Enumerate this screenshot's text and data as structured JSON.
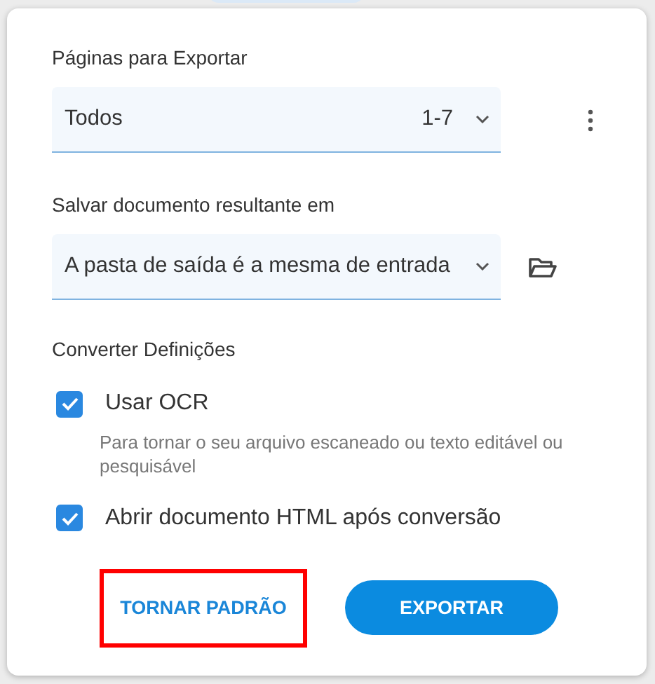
{
  "pages": {
    "label": "Páginas para Exportar",
    "value": "Todos",
    "range": "1-7"
  },
  "output": {
    "label": "Salvar documento resultante em",
    "value": "A pasta de saída é a mesma de entrada"
  },
  "settings": {
    "heading": "Converter Definições",
    "options": [
      {
        "label": "Usar OCR",
        "checked": true,
        "help": "Para tornar o seu arquivo escaneado ou texto editável ou pesquisável"
      },
      {
        "label": "Abrir documento HTML após conversão",
        "checked": true
      }
    ]
  },
  "buttons": [
    {
      "kind": "text",
      "label": "TORNAR PADRÃO",
      "highlighted": true
    },
    {
      "kind": "primary",
      "label": "EXPORTAR",
      "highlighted": false
    }
  ]
}
